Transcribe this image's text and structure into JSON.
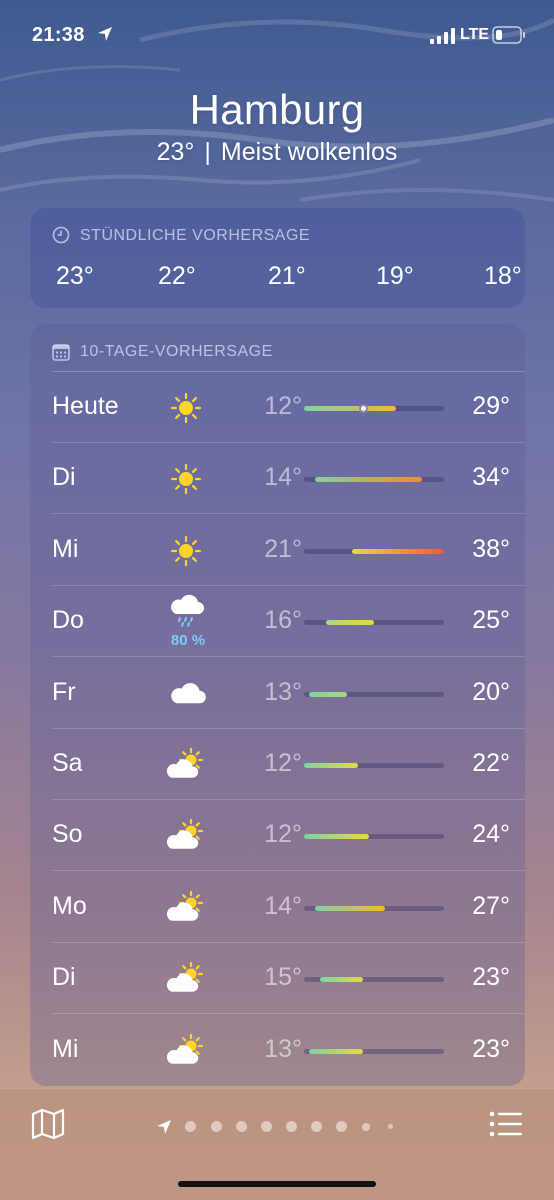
{
  "status_bar": {
    "time": "21:38",
    "network": "LTE"
  },
  "header": {
    "city": "Hamburg",
    "current_temp": "23°",
    "separator": "|",
    "condition": "Meist wolkenlos"
  },
  "hourly": {
    "title": "STÜNDLICHE VORHERSAGE",
    "icon": "clock-icon",
    "temps": [
      "23°",
      "22°",
      "21°",
      "19°",
      "18°"
    ]
  },
  "ten_day": {
    "title": "10-TAGE-VORHERSAGE",
    "icon": "calendar-icon",
    "range_min": 12,
    "range_max": 38,
    "days": [
      {
        "name": "Heute",
        "icon": "sun-icon",
        "precip": "",
        "low": "12°",
        "high": "29°",
        "low_val": 12,
        "high_val": 29,
        "current_val": 23
      },
      {
        "name": "Di",
        "icon": "sun-icon",
        "precip": "",
        "low": "14°",
        "high": "34°",
        "low_val": 14,
        "high_val": 34
      },
      {
        "name": "Mi",
        "icon": "sun-icon",
        "precip": "",
        "low": "21°",
        "high": "38°",
        "low_val": 21,
        "high_val": 38
      },
      {
        "name": "Do",
        "icon": "rain-cloud-icon",
        "precip": "80 %",
        "low": "16°",
        "high": "25°",
        "low_val": 16,
        "high_val": 25
      },
      {
        "name": "Fr",
        "icon": "cloud-icon",
        "precip": "",
        "low": "13°",
        "high": "20°",
        "low_val": 13,
        "high_val": 20
      },
      {
        "name": "Sa",
        "icon": "partly-cloudy-icon",
        "precip": "",
        "low": "12°",
        "high": "22°",
        "low_val": 12,
        "high_val": 22
      },
      {
        "name": "So",
        "icon": "partly-cloudy-icon",
        "precip": "",
        "low": "12°",
        "high": "24°",
        "low_val": 12,
        "high_val": 24
      },
      {
        "name": "Mo",
        "icon": "partly-cloudy-icon",
        "precip": "",
        "low": "14°",
        "high": "27°",
        "low_val": 14,
        "high_val": 27
      },
      {
        "name": "Di",
        "icon": "partly-cloudy-icon",
        "precip": "",
        "low": "15°",
        "high": "23°",
        "low_val": 15,
        "high_val": 23
      },
      {
        "name": "Mi",
        "icon": "partly-cloudy-icon",
        "precip": "",
        "low": "13°",
        "high": "23°",
        "low_val": 13,
        "high_val": 23
      }
    ]
  },
  "toolbar": {
    "map_icon": "map-icon",
    "list_icon": "list-icon",
    "page_count": 9,
    "current_page": 0
  },
  "colors": {
    "precip_text": "#7ccbff",
    "sun": "#ffd426"
  }
}
